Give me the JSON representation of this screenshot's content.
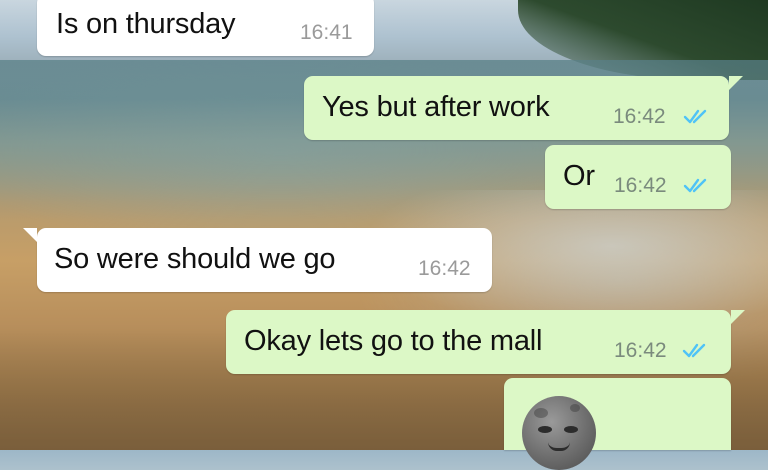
{
  "messages": [
    {
      "direction": "in",
      "text": "Is on thursday",
      "time": "16:41"
    },
    {
      "direction": "out",
      "text": "Yes but after work",
      "time": "16:42",
      "status": "read"
    },
    {
      "direction": "out",
      "text": "Or",
      "time": "16:42",
      "status": "read"
    },
    {
      "direction": "in",
      "text": "So were should we go",
      "time": "16:42"
    },
    {
      "direction": "out",
      "text": "Okay lets go to the mall",
      "time": "16:42",
      "status": "read"
    },
    {
      "direction": "out",
      "text": "",
      "emoji": "new-moon-face",
      "time": "",
      "status": ""
    }
  ],
  "colors": {
    "incoming_bubble": "#ffffff",
    "outgoing_bubble": "#dcf8c6",
    "read_ticks": "#4fc3f7",
    "time_text": "#9a9a9a"
  },
  "icons": {
    "read_receipt": "double-check-icon",
    "emoji": "new-moon-face-icon"
  }
}
